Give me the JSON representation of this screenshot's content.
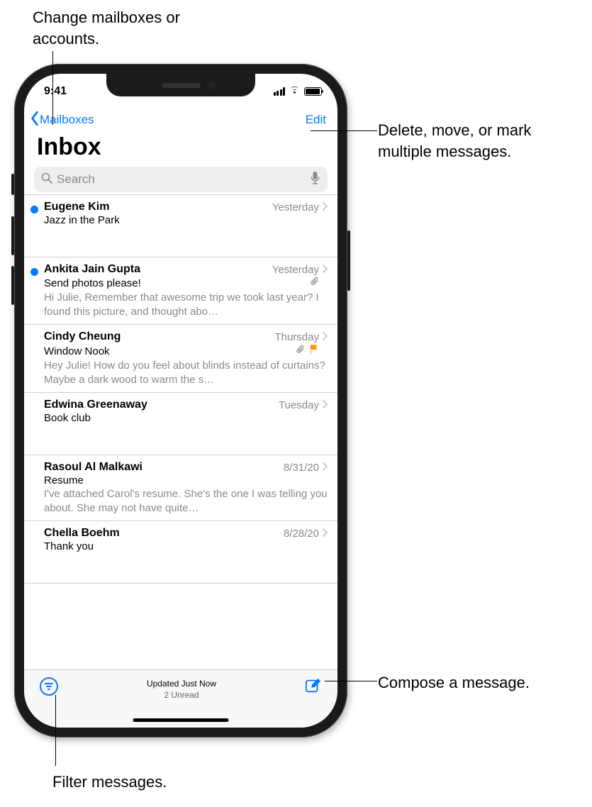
{
  "callouts": {
    "mailboxes": "Change mailboxes or accounts.",
    "edit": "Delete, move, or mark multiple messages.",
    "compose": "Compose a message.",
    "filter": "Filter messages."
  },
  "statusBar": {
    "time": "9:41"
  },
  "nav": {
    "back": "Mailboxes",
    "edit": "Edit",
    "title": "Inbox"
  },
  "search": {
    "placeholder": "Search"
  },
  "messages": [
    {
      "unread": true,
      "sender": "Eugene Kim",
      "date": "Yesterday",
      "subject": "Jazz in the Park",
      "preview": "",
      "attachment": false,
      "flagged": false
    },
    {
      "unread": true,
      "sender": "Ankita Jain Gupta",
      "date": "Yesterday",
      "subject": "Send photos please!",
      "preview": "Hi Julie, Remember that awesome trip we took last year? I found this picture, and thought abo…",
      "attachment": true,
      "flagged": false
    },
    {
      "unread": false,
      "sender": "Cindy Cheung",
      "date": "Thursday",
      "subject": "Window Nook",
      "preview": "Hey Julie! How do you feel about blinds instead of curtains? Maybe a dark wood to warm the s…",
      "attachment": true,
      "flagged": true
    },
    {
      "unread": false,
      "sender": "Edwina Greenaway",
      "date": "Tuesday",
      "subject": "Book club",
      "preview": "",
      "attachment": false,
      "flagged": false
    },
    {
      "unread": false,
      "sender": "Rasoul Al Malkawi",
      "date": "8/31/20",
      "subject": "Resume",
      "preview": "I've attached Carol's resume. She's the one I was telling you about. She may not have quite…",
      "attachment": false,
      "flagged": false
    },
    {
      "unread": false,
      "sender": "Chella Boehm",
      "date": "8/28/20",
      "subject": "Thank you",
      "preview": "",
      "attachment": false,
      "flagged": false
    }
  ],
  "toolbar": {
    "status": "Updated Just Now",
    "unread": "2 Unread"
  }
}
